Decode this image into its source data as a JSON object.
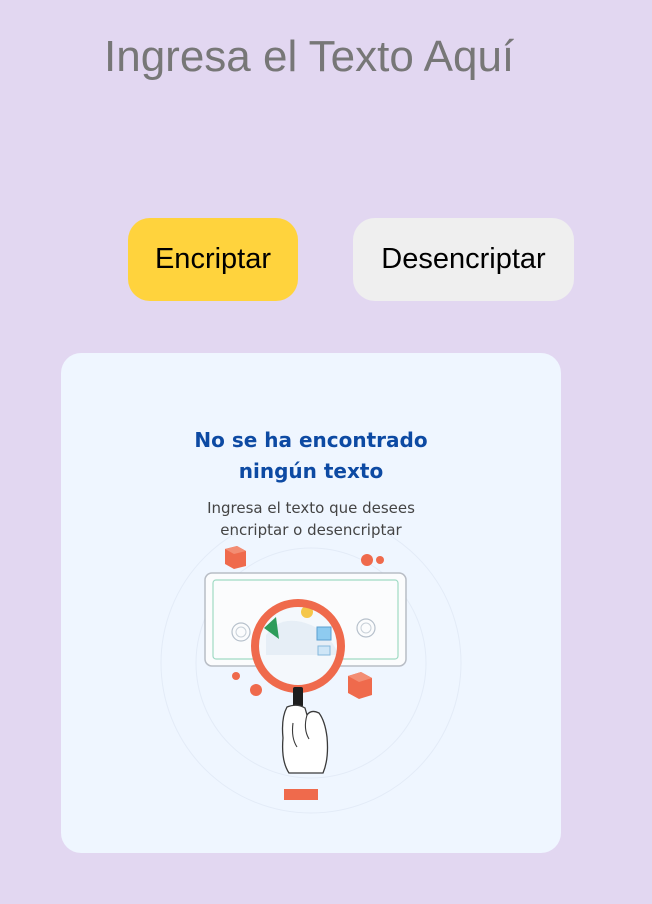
{
  "input": {
    "placeholder": "Ingresa el Texto Aquí"
  },
  "buttons": {
    "encrypt_label": "Encriptar",
    "decrypt_label": "Desencriptar"
  },
  "output": {
    "title_line1": "No se ha encontrado",
    "title_line2": "ningún texto",
    "subtitle_line1": "Ingresa el texto que desees",
    "subtitle_line2": "encriptar o desencriptar",
    "illustration_icon": "magnifying-glass-icon"
  },
  "colors": {
    "background": "#e2d7f1",
    "encrypt_button": "#ffd33d",
    "decrypt_button": "#efefef",
    "card": "#eff6ff",
    "title": "#0d4aa3",
    "accent": "#ef6a4c"
  }
}
